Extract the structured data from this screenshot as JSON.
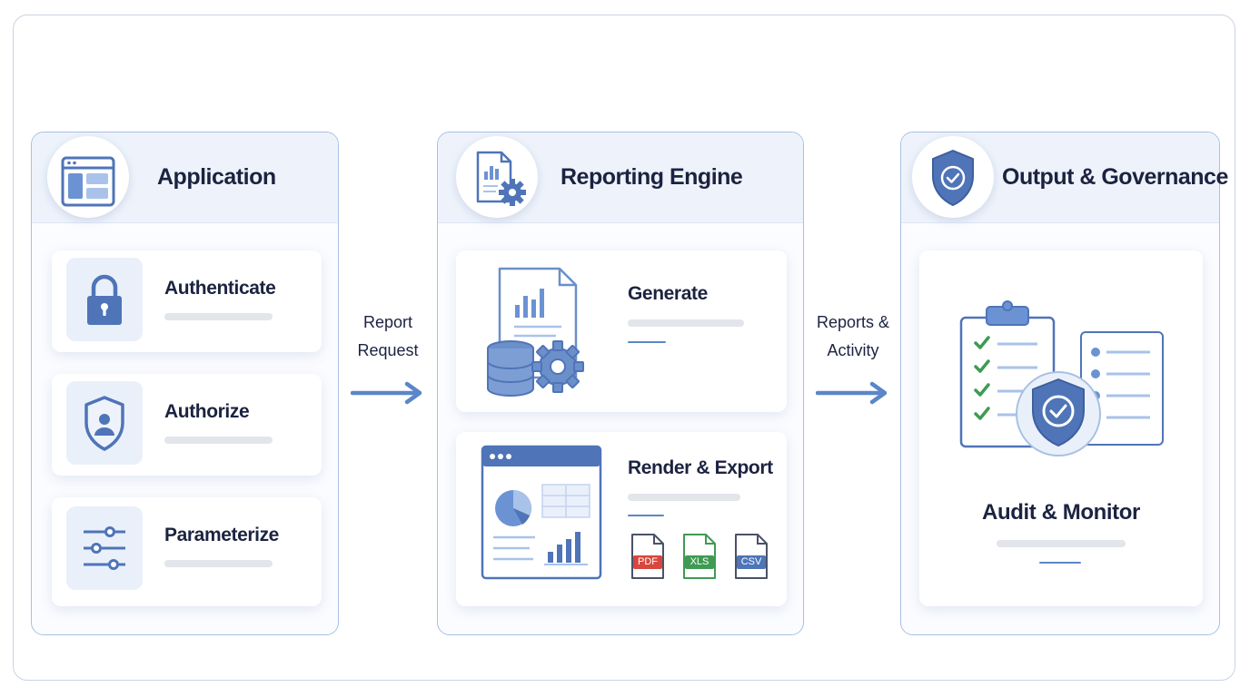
{
  "colors": {
    "primary": "#4f74b8",
    "accent": "#5b86c8",
    "panel_border": "#a9c0e3",
    "header_bg": "#eef3fb",
    "text": "#1c2340",
    "pdf": "#d9463d",
    "xls": "#3f9a53",
    "csv": "#4f74b8",
    "check": "#3f9a53"
  },
  "panels": {
    "application": {
      "title": "Application",
      "icon": "window-layout-icon",
      "items": [
        {
          "label": "Authenticate",
          "icon": "padlock-icon"
        },
        {
          "label": "Authorize",
          "icon": "shield-user-icon"
        },
        {
          "label": "Parameterize",
          "icon": "sliders-icon"
        }
      ]
    },
    "engine": {
      "title": "Reporting Engine",
      "icon": "report-gear-icon",
      "generate": {
        "label": "Generate",
        "icon": "document-database-gear-icon"
      },
      "render": {
        "label": "Render & Export",
        "icon": "dashboard-window-icon",
        "formats": [
          "PDF",
          "XLS",
          "CSV"
        ]
      }
    },
    "output": {
      "title": "Output & Governance",
      "icon": "shield-check-icon",
      "audit": {
        "label": "Audit & Monitor",
        "icon": "clipboard-shield-icon"
      }
    }
  },
  "flows": {
    "request": {
      "line1": "Report",
      "line2": "Request"
    },
    "activity": {
      "line1": "Reports &",
      "line2": "Activity"
    }
  }
}
